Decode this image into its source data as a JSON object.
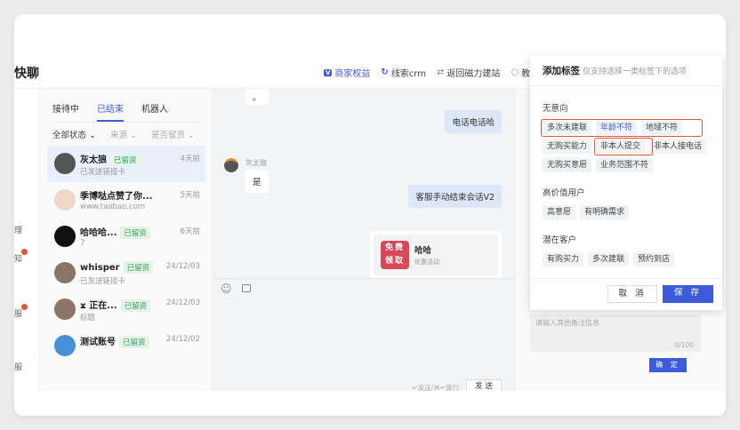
{
  "app": {
    "title": "快聊"
  },
  "nav": [
    {
      "icon": "benefits-icon",
      "label": "商家权益"
    },
    {
      "icon": "crm-icon",
      "label": "线索crm"
    },
    {
      "icon": "swap-icon",
      "label": "返回磁力建站"
    },
    {
      "icon": "tutorial-icon",
      "label": "教程"
    }
  ],
  "sidebar": [
    "理",
    "知",
    "服",
    "服"
  ],
  "tabs": [
    "接待中",
    "已结束",
    "机器人"
  ],
  "filters": [
    "全部状态 ⌄",
    "来源 ⌄",
    "是否留资 ⌄"
  ],
  "conversations": [
    {
      "name": "灰太狼",
      "tag": "已留资",
      "sub": "已发送链接卡",
      "time": "4天前"
    },
    {
      "name": "季博哒点赞了你...",
      "tag": "",
      "sub": "www.taobao.com",
      "time": "5天前"
    },
    {
      "name": "哈哈哈...",
      "tag": "已留资",
      "sub": "7",
      "time": "6天前"
    },
    {
      "name": "whisper",
      "tag": "已留资",
      "sub": "已发送链接卡",
      "time": "24/12/03"
    },
    {
      "name": "ϫ 正在...",
      "tag": "已留资",
      "sub": "标题",
      "time": "24/12/03"
    },
    {
      "name": "测试账号",
      "tag": "已留资",
      "sub": "",
      "time": "24/12/02"
    }
  ],
  "chat": {
    "m0": "。",
    "m1": "电话电话哈",
    "sender": "灰太狼",
    "m2": "是",
    "m3": "客服手动结束会话V2",
    "card": {
      "badge": "免费领取",
      "title": "哈哈",
      "sub": "优惠活动"
    },
    "hint": "↵发送/⌘↵换行",
    "send": "发 送"
  },
  "remark": {
    "placeholder": "请输入其他备注信息",
    "count": "0/100",
    "confirm": "确 定"
  },
  "modal": {
    "title": "添加标签",
    "hint": "仅支持选择一类标签下的选项",
    "groups": [
      {
        "name": "无意向",
        "tags": [
          "多次未建联",
          "年龄不符",
          "地域不符",
          "无购买能力",
          "非本人提交",
          "非本人接电话",
          "无购买意愿",
          "业务范围不符"
        ]
      },
      {
        "name": "高价值用户",
        "tags": [
          "高意愿",
          "有明确需求"
        ]
      },
      {
        "name": "潜在客户",
        "tags": [
          "有购买力",
          "多次建联",
          "预约到店"
        ]
      }
    ],
    "selected": "年龄不符",
    "cancel": "取 消",
    "save": "保 存"
  },
  "colors": {
    "accent": "#3b5bdb",
    "highlight": "#e5533d",
    "tag_green": "#3a9a5a"
  }
}
